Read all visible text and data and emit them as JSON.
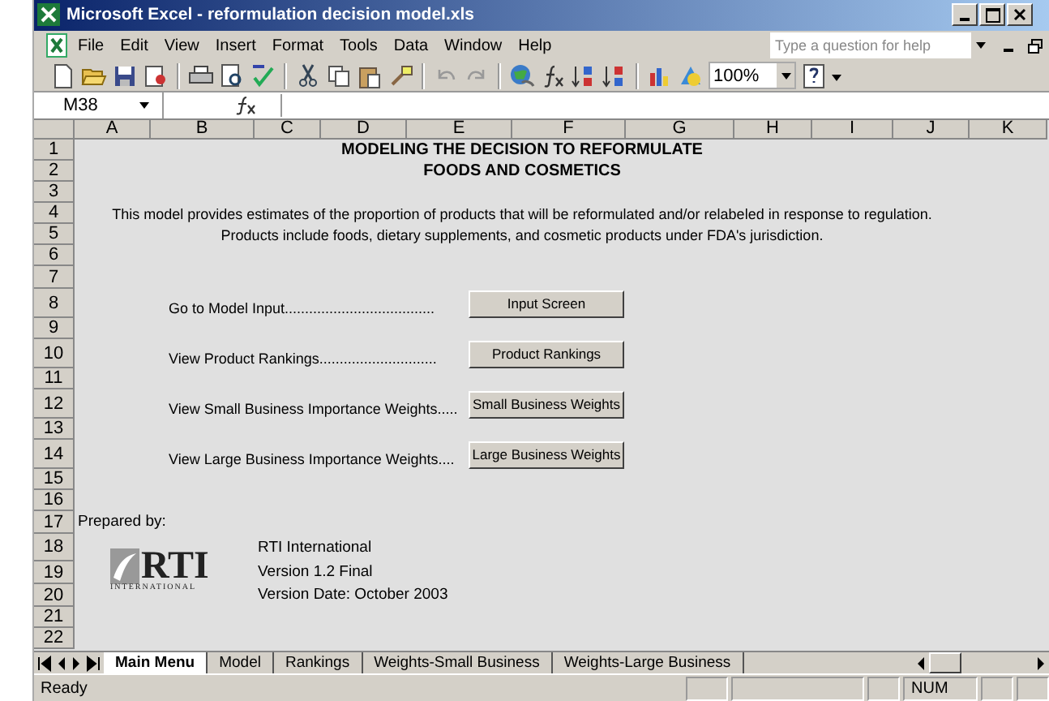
{
  "window": {
    "title": "Microsoft Excel - reformulation decision model.xls"
  },
  "menu": [
    "File",
    "Edit",
    "View",
    "Insert",
    "Format",
    "Tools",
    "Data",
    "Window",
    "Help"
  ],
  "help_search": {
    "placeholder": "Type a question for help"
  },
  "toolbar": {
    "zoom": "100%"
  },
  "formula_bar": {
    "name_box": "M38"
  },
  "columns": [
    "A",
    "B",
    "C",
    "D",
    "E",
    "F",
    "G",
    "H",
    "I",
    "J",
    "K"
  ],
  "rows": [
    "1",
    "2",
    "3",
    "4",
    "5",
    "6",
    "7",
    "8",
    "9",
    "10",
    "11",
    "12",
    "13",
    "14",
    "15",
    "16",
    "17",
    "18",
    "19",
    "20",
    "21",
    "22"
  ],
  "sheet": {
    "title_lines": [
      "MODELING THE DECISION TO REFORMULATE",
      "FOODS AND COSMETICS"
    ],
    "description_lines": [
      "This model provides estimates of the proportion of products that will be reformulated and/or relabeled in response to regulation.",
      "Products include foods, dietary supplements, and cosmetic products under FDA's jurisdiction."
    ],
    "links": [
      {
        "label": "Go to Model Input.....................................",
        "button": "Input Screen"
      },
      {
        "label": "View Product Rankings.............................",
        "button": "Product Rankings"
      },
      {
        "label": "View Small Business Importance Weights.....",
        "button": "Small Business Weights"
      },
      {
        "label": "View Large Business Importance Weights....",
        "button": "Large Business Weights"
      }
    ],
    "prepared_by": "Prepared by:",
    "logo": {
      "text": "RTI",
      "subtext": "INTERNATIONAL"
    },
    "credits": [
      "RTI International",
      "Version 1.2 Final",
      "Version Date: October 2003"
    ]
  },
  "sheet_tabs": [
    {
      "label": "Main Menu",
      "selected": true
    },
    {
      "label": "Model",
      "selected": false
    },
    {
      "label": "Rankings",
      "selected": false
    },
    {
      "label": "Weights-Small Business",
      "selected": false
    },
    {
      "label": "Weights-Large Business",
      "selected": false
    }
  ],
  "status_bar": {
    "mode": "Ready",
    "indicator": "NUM"
  }
}
